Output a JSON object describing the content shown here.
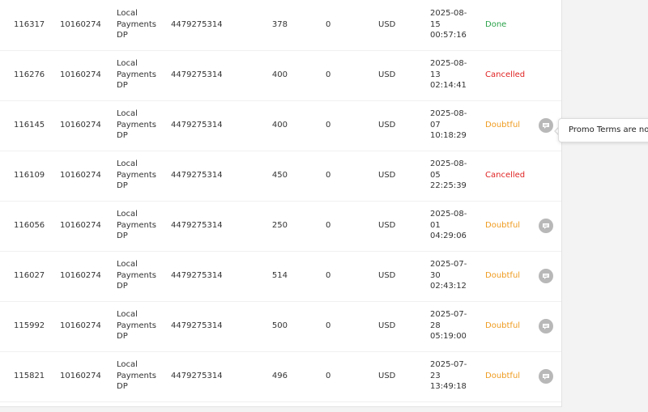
{
  "transactions": [
    {
      "id": "116317",
      "account": "10160274",
      "method": [
        "Local",
        "Payments",
        "DP"
      ],
      "phone": "4479275314",
      "amount": "378",
      "fee": "0",
      "currency": "USD",
      "date": [
        "2025-08-",
        "15",
        "00:57:16"
      ],
      "status": "Done",
      "status_type": "done",
      "has_comment": false
    },
    {
      "id": "116276",
      "account": "10160274",
      "method": [
        "Local",
        "Payments",
        "DP"
      ],
      "phone": "4479275314",
      "amount": "400",
      "fee": "0",
      "currency": "USD",
      "date": [
        "2025-08-",
        "13",
        "02:14:41"
      ],
      "status": "Cancelled",
      "status_type": "cancelled",
      "has_comment": false
    },
    {
      "id": "116145",
      "account": "10160274",
      "method": [
        "Local",
        "Payments",
        "DP"
      ],
      "phone": "4479275314",
      "amount": "400",
      "fee": "0",
      "currency": "USD",
      "date": [
        "2025-08-",
        "07",
        "10:18:29"
      ],
      "status": "Doubtful",
      "status_type": "doubtful",
      "has_comment": true
    },
    {
      "id": "116109",
      "account": "10160274",
      "method": [
        "Local",
        "Payments",
        "DP"
      ],
      "phone": "4479275314",
      "amount": "450",
      "fee": "0",
      "currency": "USD",
      "date": [
        "2025-08-",
        "05",
        "22:25:39"
      ],
      "status": "Cancelled",
      "status_type": "cancelled",
      "has_comment": false
    },
    {
      "id": "116056",
      "account": "10160274",
      "method": [
        "Local",
        "Payments",
        "DP"
      ],
      "phone": "4479275314",
      "amount": "250",
      "fee": "0",
      "currency": "USD",
      "date": [
        "2025-08-",
        "01",
        "04:29:06"
      ],
      "status": "Doubtful",
      "status_type": "doubtful",
      "has_comment": true
    },
    {
      "id": "116027",
      "account": "10160274",
      "method": [
        "Local",
        "Payments",
        "DP"
      ],
      "phone": "4479275314",
      "amount": "514",
      "fee": "0",
      "currency": "USD",
      "date": [
        "2025-07-",
        "30",
        "02:43:12"
      ],
      "status": "Doubtful",
      "status_type": "doubtful",
      "has_comment": true
    },
    {
      "id": "115992",
      "account": "10160274",
      "method": [
        "Local",
        "Payments",
        "DP"
      ],
      "phone": "4479275314",
      "amount": "500",
      "fee": "0",
      "currency": "USD",
      "date": [
        "2025-07-",
        "28",
        "05:19:00"
      ],
      "status": "Doubtful",
      "status_type": "doubtful",
      "has_comment": true
    },
    {
      "id": "115821",
      "account": "10160274",
      "method": [
        "Local",
        "Payments",
        "DP"
      ],
      "phone": "4479275314",
      "amount": "496",
      "fee": "0",
      "currency": "USD",
      "date": [
        "2025-07-",
        "23",
        "13:49:18"
      ],
      "status": "Doubtful",
      "status_type": "doubtful",
      "has_comment": true
    }
  ],
  "tooltip": {
    "text": "Promo Terms are not y"
  },
  "colors": {
    "done": "#2aa24a",
    "cancelled": "#e02222",
    "doubtful": "#ef9b1f",
    "comment_icon": "#b8b8b8"
  },
  "icons": {
    "comment": "comment-icon"
  }
}
